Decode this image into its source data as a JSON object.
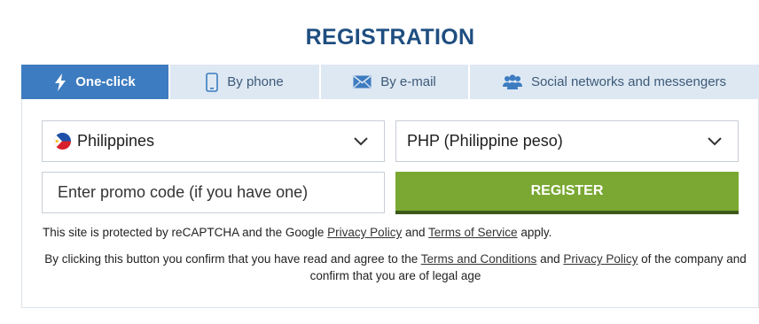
{
  "title": "REGISTRATION",
  "tabs": [
    {
      "label": "One-click",
      "icon": "lightning-icon"
    },
    {
      "label": "By phone",
      "icon": "phone-icon"
    },
    {
      "label": "By e-mail",
      "icon": "envelope-icon"
    },
    {
      "label": "Social networks and messengers",
      "icon": "people-icon"
    }
  ],
  "form": {
    "country": "Philippines",
    "currency": "PHP (Philippine peso)",
    "promo_placeholder": "Enter promo code (if you have one)",
    "register_label": "REGISTER"
  },
  "recaptcha": {
    "prefix": "This site is protected by reCAPTCHA and the Google",
    "privacy": "Privacy Policy",
    "and": "and",
    "terms": "Terms of Service",
    "suffix": "apply."
  },
  "consent": {
    "prefix": "By clicking this button you confirm that you have read and agree to the",
    "terms": "Terms and Conditions",
    "and": "and",
    "privacy": "Privacy Policy",
    "suffix": "of the company and confirm that you are of legal age"
  },
  "colors": {
    "title": "#1f4e80",
    "tab_active": "#3d7cc0",
    "tab_inactive": "#dde8f3",
    "register": "#7aa832"
  }
}
